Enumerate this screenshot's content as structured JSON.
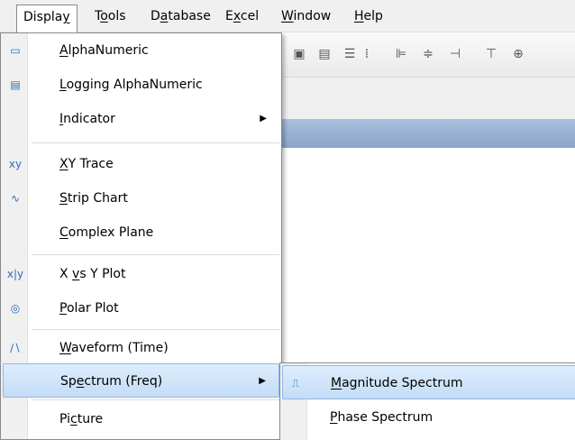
{
  "menubar": {
    "items": [
      {
        "label": "Display",
        "key": "y"
      },
      {
        "label": "Tools",
        "key": "o"
      },
      {
        "label": "Database",
        "key": "a"
      },
      {
        "label": "Excel",
        "key": "x"
      },
      {
        "label": "Window",
        "key": "W"
      },
      {
        "label": "Help",
        "key": "H"
      }
    ]
  },
  "display_menu": {
    "items": [
      {
        "label": "AlphaNumeric",
        "icon": "alphanumeric-icon"
      },
      {
        "label": "Logging AlphaNumeric",
        "icon": "logging-alphanumeric-icon"
      },
      {
        "label": "Indicator",
        "icon": ""
      },
      {
        "label": "XY Trace",
        "icon": "xy-trace-icon"
      },
      {
        "label": "Strip Chart",
        "icon": "strip-chart-icon"
      },
      {
        "label": "Complex Plane",
        "icon": ""
      },
      {
        "label": "X vs Y Plot",
        "icon": "x-vs-y-plot-icon"
      },
      {
        "label": "Polar Plot",
        "icon": "polar-plot-icon"
      },
      {
        "label": "Waveform (Time)",
        "icon": "waveform-icon"
      },
      {
        "label": "Spectrum (Freq)",
        "icon": ""
      },
      {
        "label": "Picture",
        "icon": ""
      }
    ]
  },
  "spectrum_submenu": {
    "items": [
      {
        "label": "Magnitude Spectrum",
        "icon": "magnitude-spectrum-icon"
      },
      {
        "label": "Phase Spectrum",
        "icon": ""
      }
    ]
  },
  "colors": {
    "highlight": "#c4dcf6",
    "highlight_border": "#8fb8e8",
    "title_bar": "#8aa4c9",
    "menu_bg": "#f0f0f0"
  }
}
